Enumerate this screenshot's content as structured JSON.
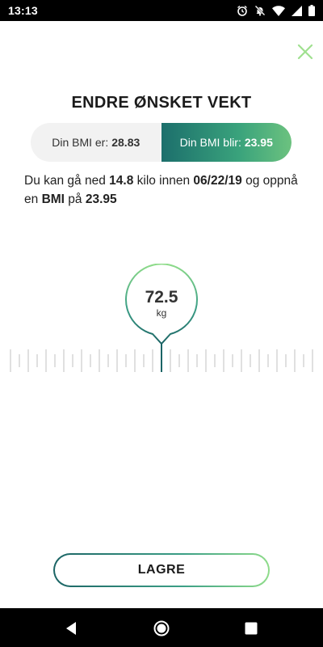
{
  "status_bar": {
    "time": "13:13",
    "icons": [
      "alarm-icon",
      "notifications-off-icon",
      "wifi-icon",
      "cell-signal-icon",
      "battery-icon"
    ]
  },
  "header": {
    "title": "ENDRE ØNSKET VEKT",
    "close_icon": "close-icon"
  },
  "bmi_toggle": {
    "current_label": "Din BMI er:",
    "current_value": "28.83",
    "target_label": "Din BMI blir:",
    "target_value": "23.95",
    "active": "target"
  },
  "info": {
    "part1": "Du kan gå ned ",
    "kilo": "14.8",
    "part2": " kilo innen ",
    "date": "06/22/19",
    "part3": " og oppnå en ",
    "bmi_word": "BMI",
    "part4": " på ",
    "bmi_value": "23.95"
  },
  "weight": {
    "value": "72.5",
    "unit": "kg"
  },
  "save": {
    "label": "LAGRE"
  },
  "nav": {
    "back_icon": "back-icon",
    "home_icon": "home-icon",
    "recents_icon": "recents-icon"
  },
  "colors": {
    "accent_dark": "#1b6465",
    "accent_mid": "#3c9f86",
    "accent_light": "#8fdc8a",
    "close": "#9fe08f"
  }
}
